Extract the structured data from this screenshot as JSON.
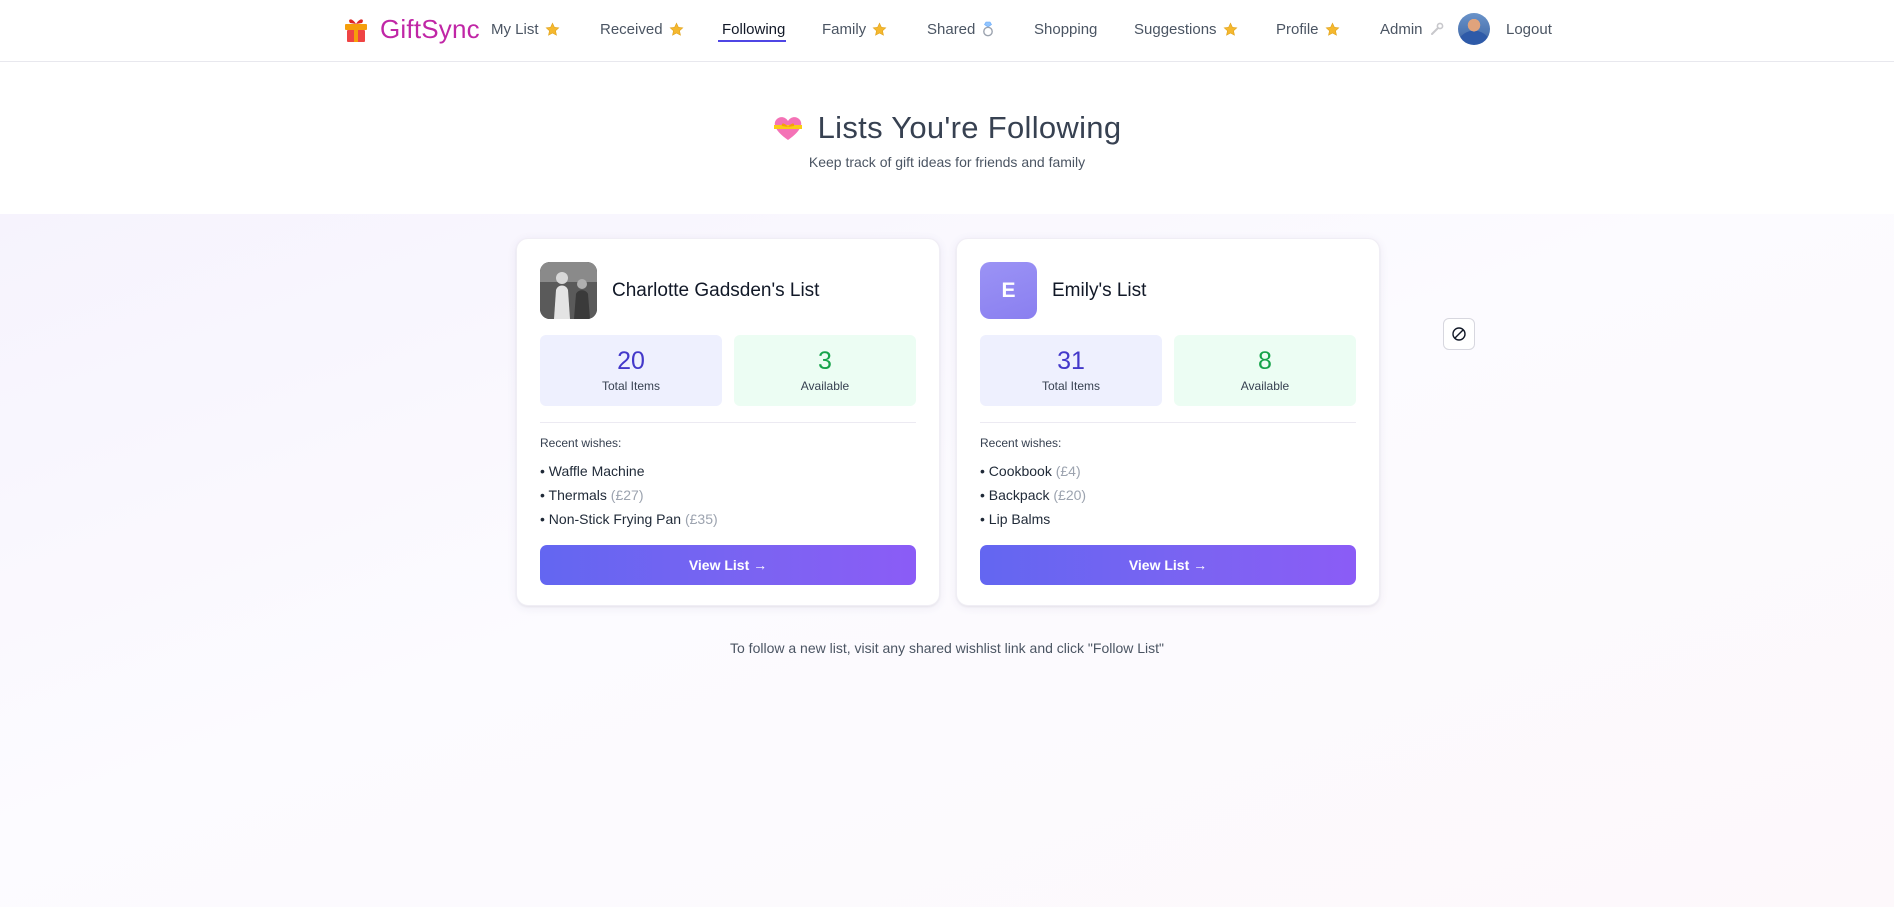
{
  "brand": {
    "name": "GiftSync",
    "icon": "gift-icon"
  },
  "nav": {
    "items": [
      {
        "label": "My List",
        "icon": "star-icon"
      },
      {
        "label": "Received",
        "icon": "star-icon"
      },
      {
        "label": "Following",
        "active": true
      },
      {
        "label": "Family",
        "icon": "star-icon"
      },
      {
        "label": "Shared",
        "icon": "ring-icon"
      },
      {
        "label": "Shopping"
      },
      {
        "label": "Suggestions",
        "icon": "star-icon"
      },
      {
        "label": "Profile",
        "icon": "star-icon"
      },
      {
        "label": "Admin",
        "icon": "wrench-icon"
      }
    ],
    "logout": "Logout",
    "avatar_icon": "user-avatar"
  },
  "header": {
    "icon": "heart-with-ribbon-icon",
    "title": "Lists You're Following",
    "subtitle": "Keep track of gift ideas for friends and family"
  },
  "cards": [
    {
      "name": "Charlotte Gadsden's List",
      "avatar": "photo",
      "total_items": "20",
      "total_label": "Total Items",
      "available": "3",
      "available_label": "Available",
      "recent_label": "Recent wishes:",
      "wishes": [
        {
          "name": "Waffle Machine",
          "price": ""
        },
        {
          "name": "Thermals",
          "price": "(£27)"
        },
        {
          "name": "Non-Stick Frying Pan",
          "price": "(£35)"
        }
      ],
      "button": "View List →"
    },
    {
      "name": "Emily's List",
      "avatar": "letter",
      "avatar_letter": "E",
      "total_items": "31",
      "total_label": "Total Items",
      "available": "8",
      "available_label": "Available",
      "recent_label": "Recent wishes:",
      "wishes": [
        {
          "name": "Cookbook",
          "price": "(£4)"
        },
        {
          "name": "Backpack",
          "price": "(£20)"
        },
        {
          "name": "Lip Balms",
          "price": ""
        }
      ],
      "button": "View List →"
    }
  ],
  "block_button_icon": "block-icon",
  "footer_note": "To follow a new list, visit any shared wishlist link and click \"Follow List\"",
  "colors": {
    "brand": "#c026a6",
    "accent": "#6366f1",
    "total_value": "#4338ca",
    "available_value": "#16a34a"
  }
}
